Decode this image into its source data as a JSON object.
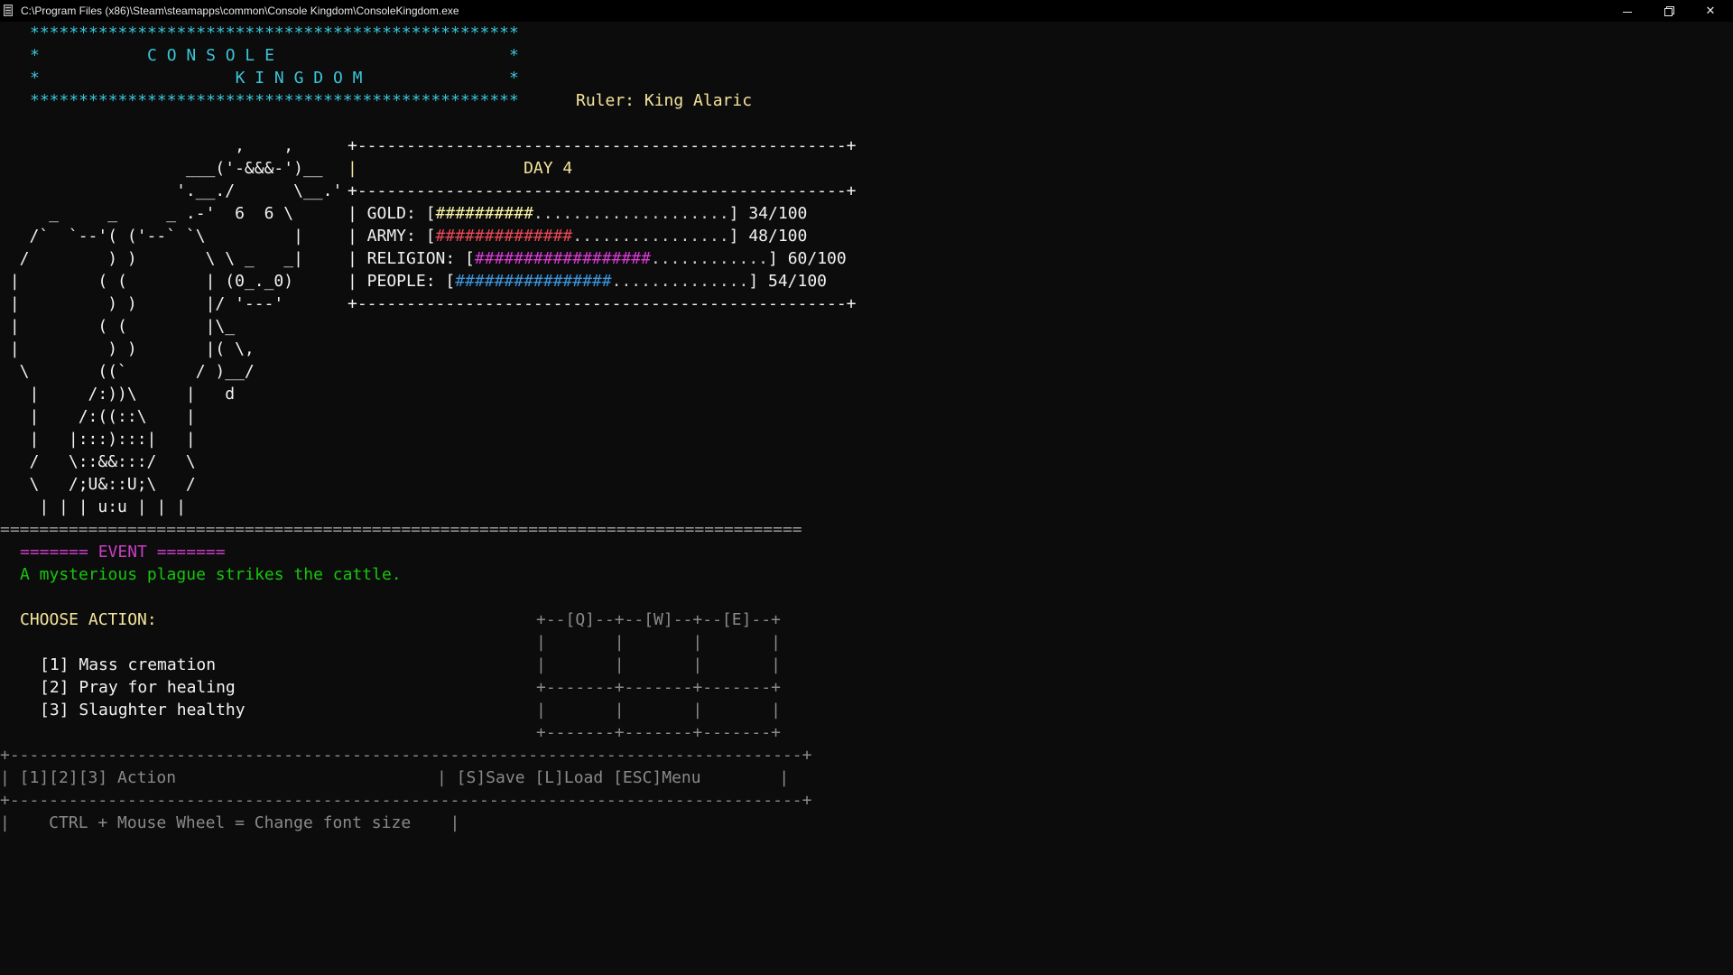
{
  "window": {
    "title": "C:\\Program Files (x86)\\Steam\\steamapps\\common\\Console Kingdom\\ConsoleKingdom.exe"
  },
  "banner": {
    "top_border": "**************************************************",
    "line1": "*           C O N S O L E                        *",
    "line2": "*                    K I N G D O M               *",
    "bottom_border": "**************************************************"
  },
  "ruler": {
    "label": "Ruler: King Alaric"
  },
  "ascii_art": [
    "                        ,    ,",
    "                   ___('-&&&-')__",
    "                  '.__./      \\__.'",
    "     _     _     _ .-'  6  6 \\",
    "   /`  `--'( ('--` `\\         |",
    "  /        ) )       \\ \\ _   _|",
    " |        ( (        | (0_._0)",
    " |         ) )       |/ '---'",
    " |        ( (        |\\_",
    " |         ) )       |( \\,",
    "  \\       ((`       / )__/",
    "   |     /:))\\     |   d",
    "   |    /:((::\\    |",
    "   |   |:::):::|   |",
    "   /   \\::&&:::/   \\",
    "   \\   /;U&::U;\\   /",
    "    | | | u:u | | |"
  ],
  "status_panel": {
    "border": "+--------------------------------------------------+",
    "day_line": "|                 DAY 4",
    "stats": [
      {
        "prefix": "| GOLD: [",
        "filled": "##########",
        "empty": "....................",
        "suffix": "] 34/100",
        "value": 34,
        "max": 100,
        "color": "#f9f1a5"
      },
      {
        "prefix": "| ARMY: [",
        "filled": "##############",
        "empty": "................",
        "suffix": "] 48/100",
        "value": 48,
        "max": 100,
        "color": "#e74856"
      },
      {
        "prefix": "| RELIGION: [",
        "filled": "##################",
        "empty": "............",
        "suffix": "] 60/100",
        "value": 60,
        "max": 100,
        "color": "#d83ad4"
      },
      {
        "prefix": "| PEOPLE: [",
        "filled": "################",
        "empty": "..............",
        "suffix": "] 54/100",
        "value": 54,
        "max": 100,
        "color": "#3a96dd"
      }
    ]
  },
  "divider": "==================================================================================",
  "event": {
    "header": "======= EVENT =======",
    "text": "A mysterious plague strikes the cattle."
  },
  "actions": {
    "prompt": "CHOOSE ACTION:",
    "options": [
      {
        "key": "[1]",
        "label": "Mass cremation"
      },
      {
        "key": "[2]",
        "label": "Pray for healing"
      },
      {
        "key": "[3]",
        "label": "Slaughter healthy"
      }
    ]
  },
  "key_grid": [
    "+--[Q]--+--[W]--+--[E]--+",
    "|       |       |       |",
    "|       |       |       |",
    "+-------+-------+-------+",
    "|       |       |       |",
    "+-------+-------+-------+"
  ],
  "footer": {
    "border": "+---------------------------------------------------------------------------------+",
    "controls_left": "| [1][2][3] Action",
    "controls_right": "| [S]Save [L]Load [ESC]Menu        |",
    "font_hint": "|    CTRL + Mouse Wheel = Change font size    |"
  }
}
